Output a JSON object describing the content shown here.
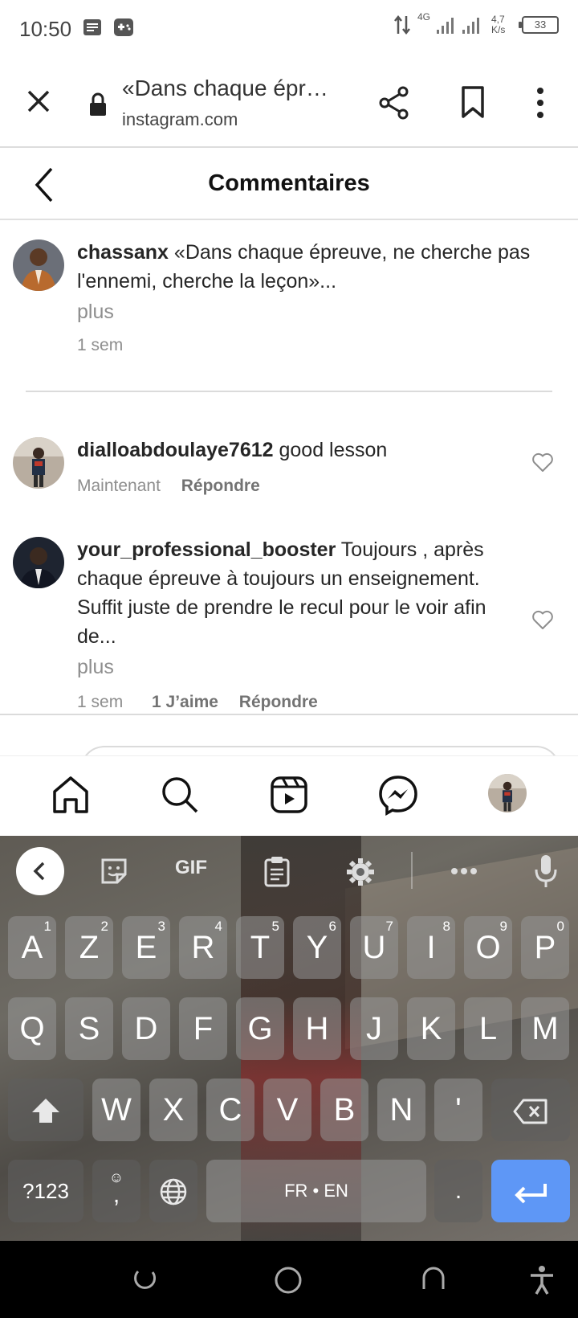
{
  "status_bar": {
    "time": "10:50",
    "network": "4G",
    "speed": "4,7 K/s",
    "battery": "33"
  },
  "browser": {
    "title": "«Dans chaque épr…",
    "url": "instagram.com"
  },
  "header": {
    "title": "Commentaires"
  },
  "caption": {
    "username": "chassanx",
    "text": " «Dans chaque épreuve, ne cherche pas l'ennemi, cherche la leçon»...",
    "more": "plus",
    "time": "1 sem"
  },
  "comments": [
    {
      "username": "dialloabdoulaye7612",
      "text": " good lesson",
      "time": "Maintenant",
      "reply": "Répondre"
    },
    {
      "username": "your_professional_booster",
      "text": " Toujours , après chaque épreuve à toujours un enseignement. Suffit juste de prendre le recul pour le voir afin de...",
      "more": "plus",
      "time": "1 sem",
      "likes": "1 J’aime",
      "reply": "Répondre"
    }
  ],
  "keyboard": {
    "gif": "GIF",
    "row1": [
      [
        "A",
        "1"
      ],
      [
        "Z",
        "2"
      ],
      [
        "E",
        "3"
      ],
      [
        "R",
        "4"
      ],
      [
        "T",
        "5"
      ],
      [
        "Y",
        "6"
      ],
      [
        "U",
        "7"
      ],
      [
        "I",
        "8"
      ],
      [
        "O",
        "9"
      ],
      [
        "P",
        "0"
      ]
    ],
    "row2": [
      "Q",
      "S",
      "D",
      "F",
      "G",
      "H",
      "J",
      "K",
      "L",
      "M"
    ],
    "row3": [
      "W",
      "X",
      "C",
      "V",
      "B",
      "N",
      "'"
    ],
    "symbols": "?123",
    "comma": ",",
    "space": "FR • EN",
    "period": "."
  },
  "colors": {
    "enter_key": "#5e97f6",
    "muted": "#8e8e8e",
    "text": "#262626"
  }
}
